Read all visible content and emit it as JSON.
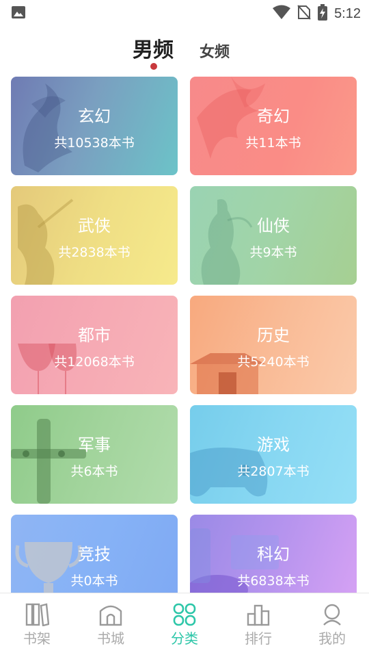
{
  "status_bar": {
    "time": "5:12"
  },
  "tabs": {
    "male": "男频",
    "female": "女频"
  },
  "categories": [
    {
      "name": "玄幻",
      "count": "共10538本书"
    },
    {
      "name": "奇幻",
      "count": "共11本书"
    },
    {
      "name": "武侠",
      "count": "共2838本书"
    },
    {
      "name": "仙侠",
      "count": "共9本书"
    },
    {
      "name": "都市",
      "count": "共12068本书"
    },
    {
      "name": "历史",
      "count": "共5240本书"
    },
    {
      "name": "军事",
      "count": "共6本书"
    },
    {
      "name": "游戏",
      "count": "共2807本书"
    },
    {
      "name": "竞技",
      "count": "共0本书"
    },
    {
      "name": "科幻",
      "count": "共6838本书"
    }
  ],
  "bottom_nav": [
    {
      "label": "书架",
      "icon": "bookshelf-icon"
    },
    {
      "label": "书城",
      "icon": "bookstore-icon"
    },
    {
      "label": "分类",
      "icon": "category-icon",
      "active": true
    },
    {
      "label": "排行",
      "icon": "ranking-icon"
    },
    {
      "label": "我的",
      "icon": "profile-icon"
    }
  ],
  "colors": {
    "accent": "#2cc6a8",
    "tab_dot": "#c8393d"
  }
}
